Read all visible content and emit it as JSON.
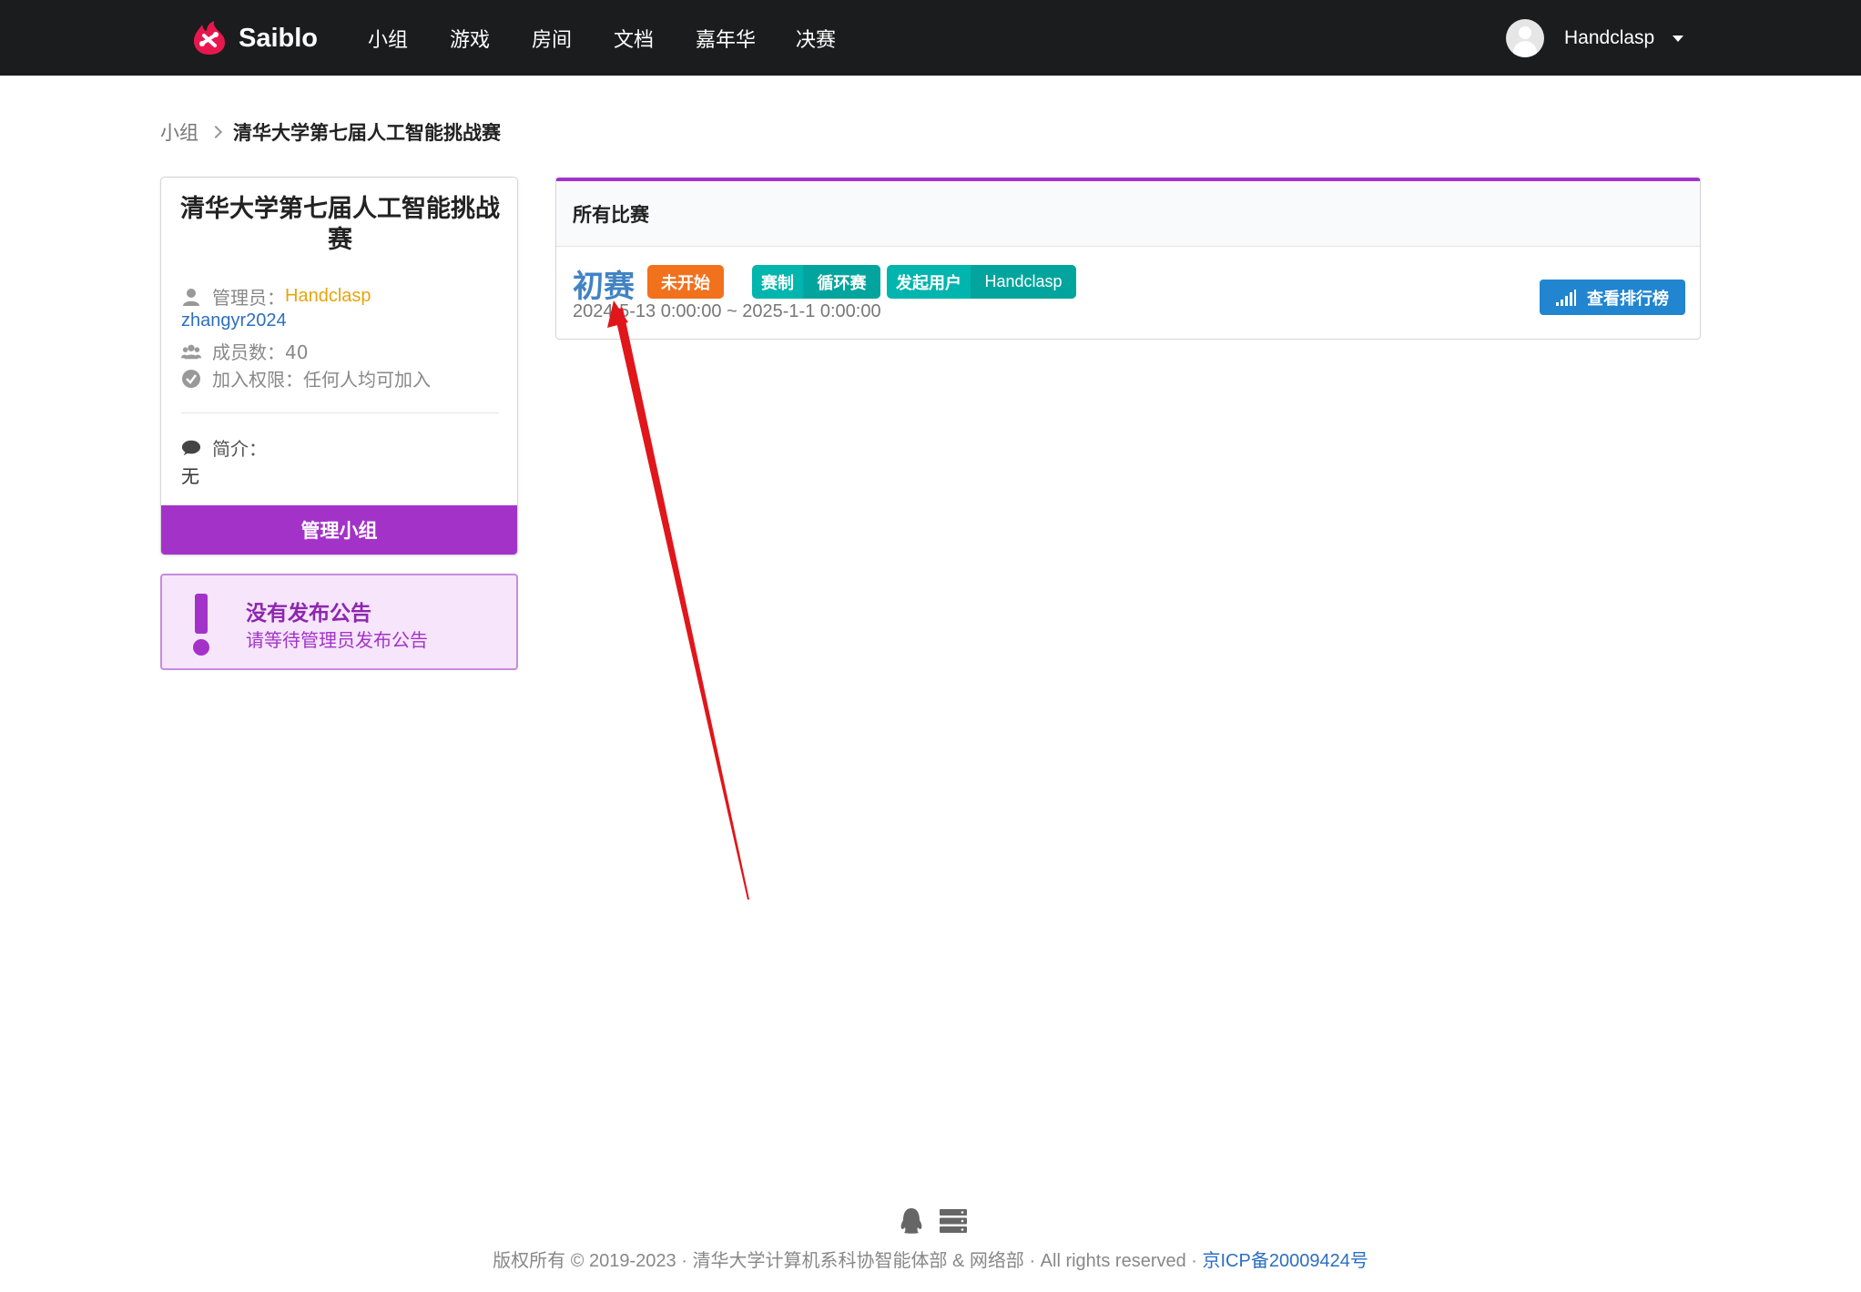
{
  "navbar": {
    "brand": "Saiblo",
    "items": [
      "小组",
      "游戏",
      "房间",
      "文档",
      "嘉年华",
      "决赛"
    ],
    "username": "Handclasp"
  },
  "breadcrumb": {
    "parent": "小组",
    "current": "清华大学第七届人工智能挑战赛"
  },
  "group": {
    "title": "清华大学第七届人工智能挑战赛",
    "admin_label": "管理员：",
    "admins": [
      "Handclasp",
      "zhangyr2024"
    ],
    "members_label": "成员数：40",
    "join_label": "加入权限：任何人均可加入",
    "intro_label": "简介：",
    "intro_text": "无",
    "manage_button": "管理小组"
  },
  "notice": {
    "title": "没有发布公告",
    "subtitle": "请等待管理员发布公告"
  },
  "contests": {
    "header": "所有比赛",
    "items": [
      {
        "name": "初赛",
        "status": "未开始",
        "format_key": "赛制",
        "format_value": "循环赛",
        "creator_key": "发起用户",
        "creator_value": "Handclasp",
        "time": "2024-5-13 0:00:00 ~ 2025-1-1 0:00:00",
        "rank_button": "查看排行榜"
      }
    ]
  },
  "footer": {
    "text": "版权所有 © 2019-2023 · 清华大学计算机系科协智能体部 & 网络部 · All rights reserved · ",
    "icp": "京ICP备20009424号"
  },
  "colors": {
    "navbar": "#1b1c1d",
    "purple": "#a333c8",
    "orange": "#f2711c",
    "teal": "#00b5ad",
    "blue": "#2185d0",
    "annotation_red": "#e0161b"
  }
}
